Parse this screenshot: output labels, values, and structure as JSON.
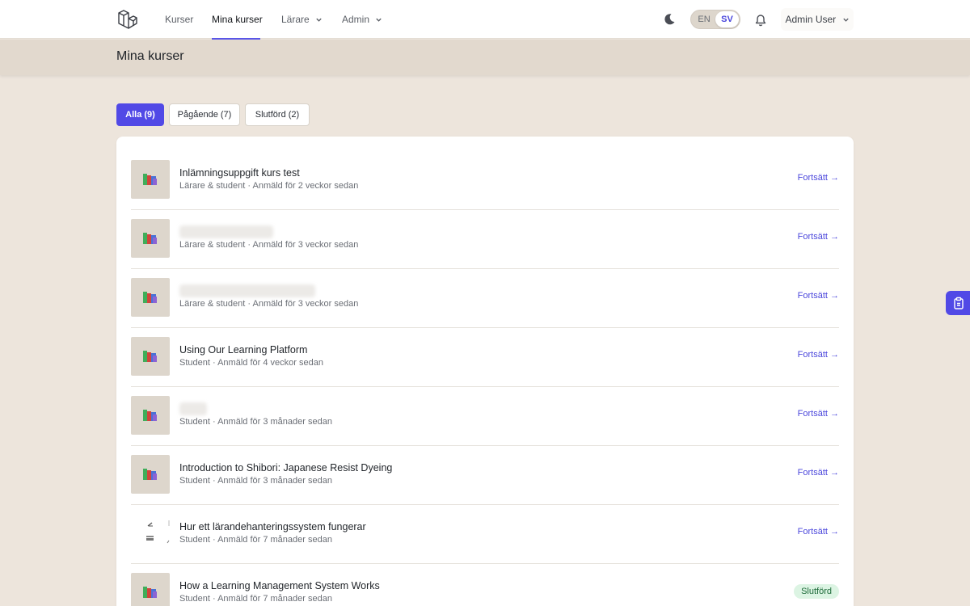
{
  "nav": {
    "links": [
      {
        "label": "Kurser"
      },
      {
        "label": "Mina kurser"
      },
      {
        "label": "Lärare"
      },
      {
        "label": "Admin"
      }
    ],
    "lang": {
      "en": "EN",
      "sv": "SV"
    },
    "user": "Admin User"
  },
  "header": {
    "title": "Mina kurser"
  },
  "filters": [
    {
      "label": "Alla (9)"
    },
    {
      "label": "Pågående (7)"
    },
    {
      "label": "Slutförd (2)"
    }
  ],
  "courses": [
    {
      "title": "Inlämningsuppgift kurs test",
      "meta": "Lärare & student · Anmäld för 2 veckor sedan",
      "action": "Fortsätt →"
    },
    {
      "title": "",
      "meta": "Lärare & student · Anmäld för 3 veckor sedan",
      "action": "Fortsätt →"
    },
    {
      "title": "",
      "meta": "Lärare & student · Anmäld för 3 veckor sedan",
      "action": "Fortsätt →"
    },
    {
      "title": "Using Our Learning Platform",
      "meta": "Student · Anmäld för 4 veckor sedan",
      "action": "Fortsätt →"
    },
    {
      "title": "",
      "meta": "Student · Anmäld för 3 månader sedan",
      "action": "Fortsätt →"
    },
    {
      "title": "Introduction to Shibori: Japanese Resist Dyeing",
      "meta": "Student · Anmäld för 3 månader sedan",
      "action": "Fortsätt →"
    },
    {
      "title": "Hur ett lärandehanteringssystem fungerar",
      "meta": "Student · Anmäld för 7 månader sedan",
      "action": "Fortsätt →"
    },
    {
      "title": "How a Learning Management System Works",
      "meta": "Student · Anmäld för 7 månader sedan",
      "status": "Slutförd"
    }
  ],
  "colors": {
    "accent": "#5149e6",
    "background": "#ede5dc",
    "done_badge": "#dcf4e3"
  }
}
